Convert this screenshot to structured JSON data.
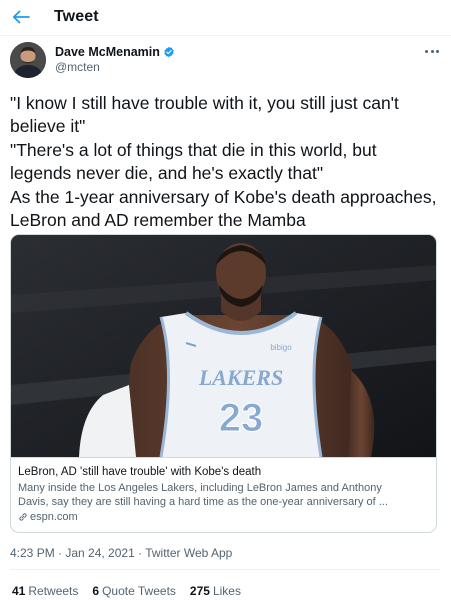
{
  "header": {
    "title": "Tweet"
  },
  "author": {
    "name": "Dave McMenamin",
    "handle": "@mcten"
  },
  "tweet": {
    "lines": [
      "\"I know I still have trouble with it, you still just can't",
      "believe it\"",
      "\"There's a lot of things that die in this world, but",
      "legends never die, and he's exactly that\"",
      "As the 1-year anniversary of Kobe's death approaches,",
      "LeBron and AD remember the Mamba"
    ]
  },
  "card": {
    "jersey_team": "LAKERS",
    "jersey_number": "23",
    "jersey_patch": "bibigo",
    "title": "LeBron, AD 'still have trouble' with Kobe's death",
    "description_lines": [
      "Many inside the Los Angeles Lakers, including LeBron James and Anthony",
      "Davis, say they are still having a hard time as the one-year anniversary of ..."
    ],
    "domain": "espn.com"
  },
  "meta": {
    "text": "4:23 PM · Jan 24, 2021 · Twitter Web App"
  },
  "stats": {
    "retweets_count": "41",
    "retweets_label": "Retweets",
    "quotes_count": "6",
    "quotes_label": "Quote Tweets",
    "likes_count": "275",
    "likes_label": "Likes"
  },
  "colors": {
    "accent": "#1d9bf0",
    "text": "#0f1419",
    "secondary": "#536471",
    "border": "#cfd9de"
  },
  "icons": {
    "back": "arrow-left-icon",
    "verified": "verified-badge-icon",
    "more": "more-dots-icon",
    "link": "link-icon"
  }
}
